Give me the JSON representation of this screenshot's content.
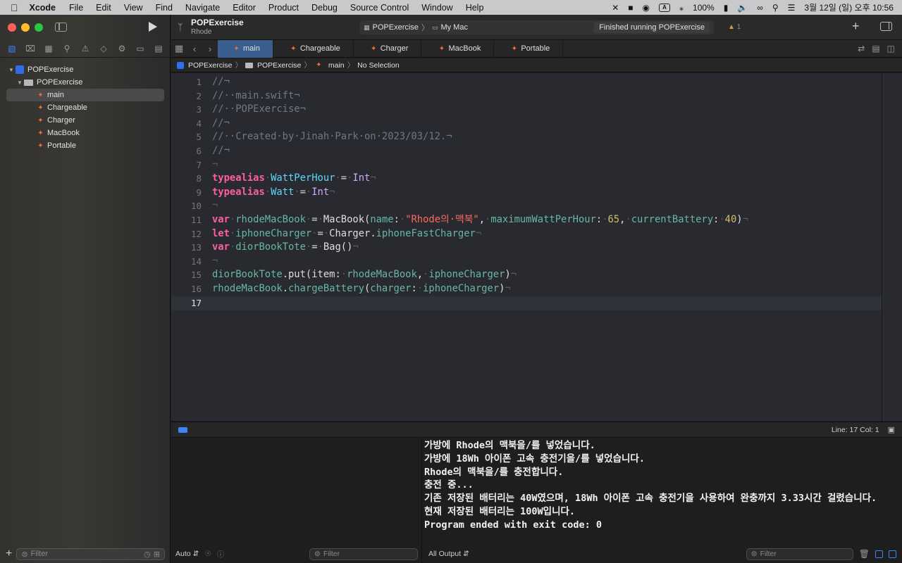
{
  "menubar": {
    "app_name": "Xcode",
    "items": [
      "File",
      "Edit",
      "View",
      "Find",
      "Navigate",
      "Editor",
      "Product",
      "Debug",
      "Source Control",
      "Window",
      "Help"
    ],
    "battery": "100%",
    "input_indicator": "A",
    "datetime": "3월 12일 (일) 오후 10:56"
  },
  "toolbar": {
    "project_name": "POPExercise",
    "branch": "Rhode",
    "scheme": "POPExercise",
    "destination": "My Mac",
    "status": "Finished running POPExercise",
    "warning_count": "1"
  },
  "navigator": {
    "project": "POPExercise",
    "group": "POPExercise",
    "files": [
      "main",
      "Chargeable",
      "Charger",
      "MacBook",
      "Portable"
    ],
    "filter_placeholder": "Filter"
  },
  "tabs": [
    "main",
    "Chargeable",
    "Charger",
    "MacBook",
    "Portable"
  ],
  "jumpbar": {
    "project": "POPExercise",
    "group": "POPExercise",
    "file": "main",
    "selection": "No Selection"
  },
  "editor": {
    "line_numbers": [
      "1",
      "2",
      "3",
      "4",
      "5",
      "6",
      "7",
      "8",
      "9",
      "10",
      "11",
      "12",
      "13",
      "14",
      "15",
      "16",
      "17"
    ],
    "comment_lines": [
      "//¬",
      "//··main.swift¬",
      "//··POPExercise¬",
      "//¬",
      "//··Created·by·Jinah·Park·on·2023/03/12.¬",
      "//¬"
    ],
    "code_lines": {
      "l8": [
        "typealias",
        "WattPerHour",
        "Int"
      ],
      "l9": [
        "typealias",
        "Watt",
        "Int"
      ],
      "l11": [
        "var",
        "rhodeMacBook",
        "MacBook",
        "name",
        "\"Rhode의·맥북\"",
        "maximumWattPerHour",
        "65",
        "currentBattery",
        "40"
      ],
      "l12": [
        "let",
        "iphoneCharger",
        "Charger",
        "iphoneFastCharger"
      ],
      "l13": [
        "var",
        "diorBookTote",
        "Bag"
      ],
      "l15": [
        "diorBookTote",
        "put",
        "item",
        "rhodeMacBook",
        "iphoneCharger"
      ],
      "l16": [
        "rhodeMacBook",
        "chargeBattery",
        "charger",
        "iphoneCharger"
      ]
    },
    "cursor_info": "Line: 17  Col: 1"
  },
  "console": {
    "output": [
      "가방에 Rhode의 맥북을/를 넣었습니다.",
      "가방에 18Wh 아이폰 고속 충전기을/를 넣었습니다.",
      "Rhode의 맥북을/를 충전합니다.",
      "충전 중...",
      "기존 저장된 배터리는 40W였으며, 18Wh 아이폰 고속 충전기을 사용하여 완충까지 3.33시간 걸렸습니다.",
      "현재 저장된 배터리는 100W입니다.",
      "Program ended with exit code: 0"
    ],
    "variables_mode": "Auto",
    "output_mode": "All Output",
    "filter_placeholder": "Filter"
  },
  "colors": {
    "accent": "#3d85f5",
    "keyword": "#fc5fa3",
    "type": "#5dd8ff",
    "string": "#fc6a5d",
    "number": "#d0bf69",
    "comment": "#6c7986"
  }
}
